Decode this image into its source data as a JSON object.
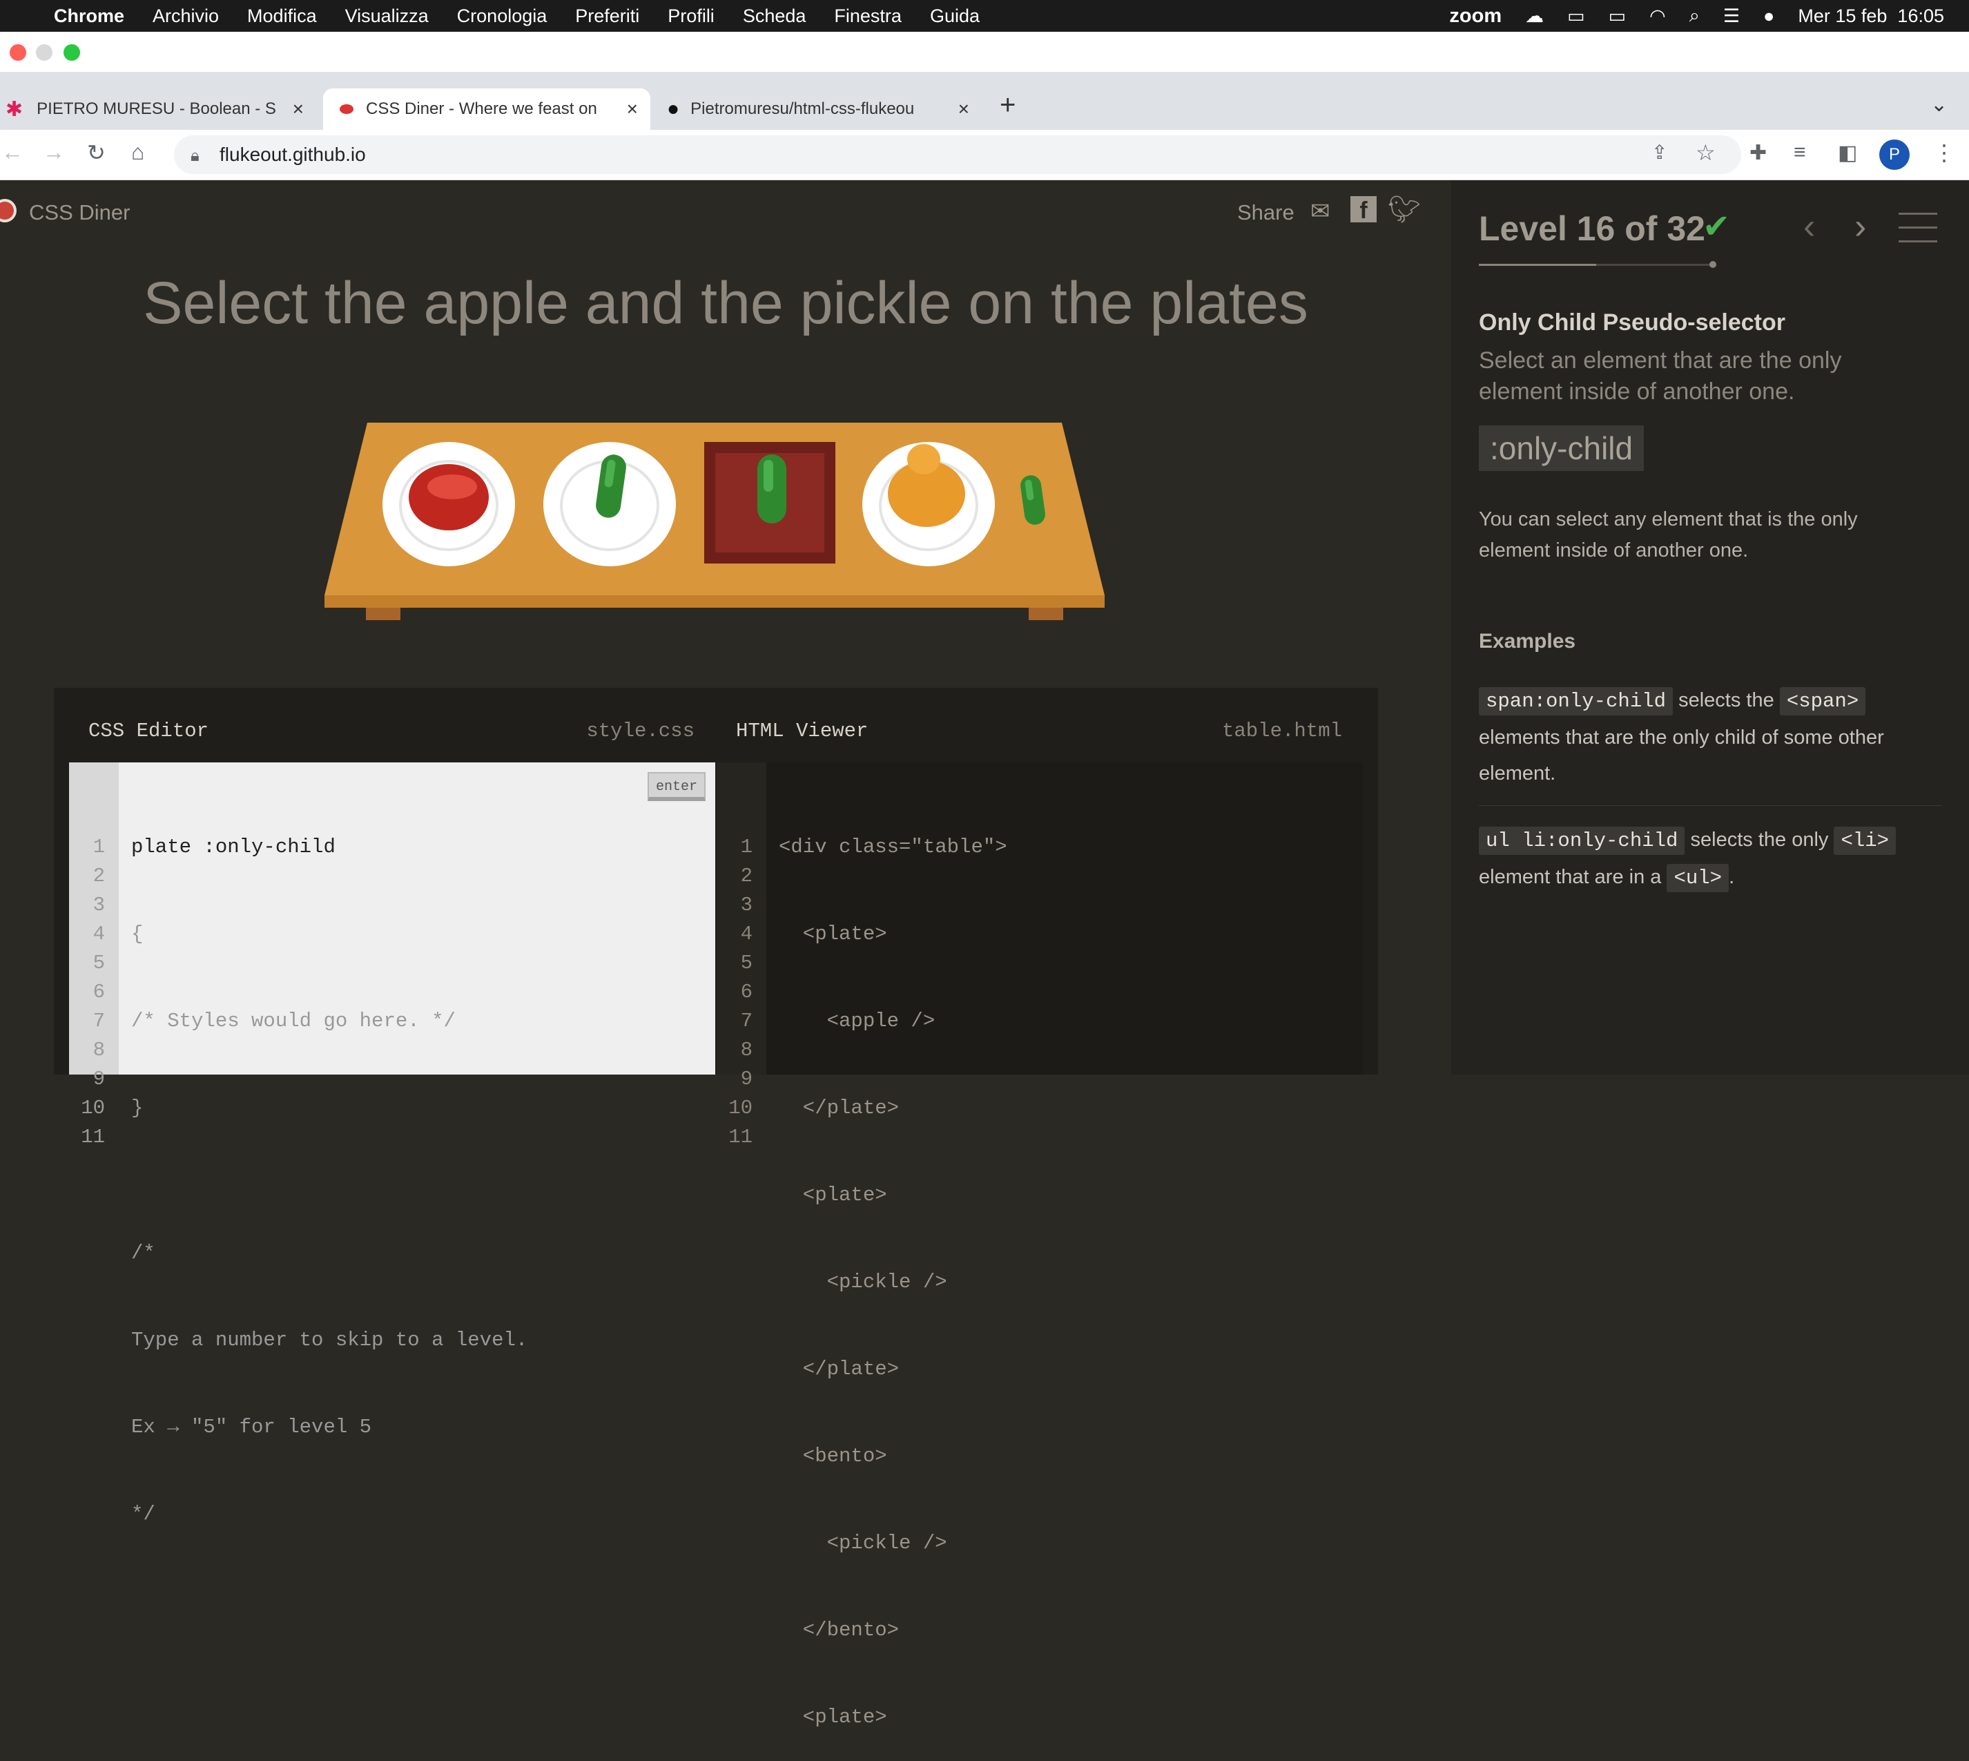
{
  "menubar": {
    "app": "Chrome",
    "items": [
      "Archivio",
      "Modifica",
      "Visualizza",
      "Cronologia",
      "Preferiti",
      "Profili",
      "Scheda",
      "Finestra",
      "Guida"
    ],
    "zoom": "zoom",
    "clock": "Mer 15 feb  16:05"
  },
  "tabs": [
    {
      "title": "PIETRO MURESU - Boolean - S"
    },
    {
      "title": "CSS Diner - Where we feast on"
    },
    {
      "title": "Pietromuresu/html-css-flukeou"
    }
  ],
  "address": {
    "url": "flukeout.github.io",
    "profile_initial": "P"
  },
  "game": {
    "logo": "CSS Diner",
    "share_label": "Share",
    "instruction": "Select the apple and the pickle on the plates"
  },
  "css_editor": {
    "title": "CSS Editor",
    "filename": "style.css",
    "enter_label": "enter",
    "line_numbers": [
      "1",
      "2",
      "3",
      "4",
      "5",
      "6",
      "7",
      "8",
      "9",
      "10",
      "11"
    ],
    "lines": [
      "plate :only-child",
      "{",
      "/* Styles would go here. */",
      "}",
      "",
      "/*",
      "Type a number to skip to a level.",
      "Ex → \"5\" for level 5",
      "*/",
      "",
      ""
    ]
  },
  "html_viewer": {
    "title": "HTML Viewer",
    "filename": "table.html",
    "line_numbers": [
      "1",
      "2",
      "3",
      "4",
      "5",
      "6",
      "7",
      "8",
      "9",
      "10",
      "11"
    ],
    "lines": [
      "<div class=\"table\">",
      "  <plate>",
      "    <apple />",
      "  </plate>",
      "  <plate>",
      "    <pickle />",
      "  </plate>",
      "  <bento>",
      "    <pickle />",
      "  </bento>",
      "  <plate>"
    ]
  },
  "sidebar": {
    "level_label": "Level 16 of 32",
    "check": "✔",
    "progress": 0.5,
    "selector_name": "Only Child Pseudo-selector",
    "selector_summary": "Select an element that are the only element inside of another one.",
    "syntax": ":only-child",
    "description": "You can select any element that is the only element inside of another one.",
    "examples_title": "Examples",
    "example1": {
      "code": "span:only-child",
      "t1": "selects the",
      "code2": "<span>",
      "t2": "elements that are the only child of some other element."
    },
    "example2": {
      "code": "ul li:only-child",
      "t1": "selects the only",
      "code2": "<li>",
      "t2": "element that are in a",
      "code3": "<ul>",
      "t3": "."
    }
  },
  "colors": {
    "page_bg": "#2b2924",
    "sidebar_bg": "#242320",
    "table_wood": "#d9963a",
    "check_green": "#4caf50"
  }
}
